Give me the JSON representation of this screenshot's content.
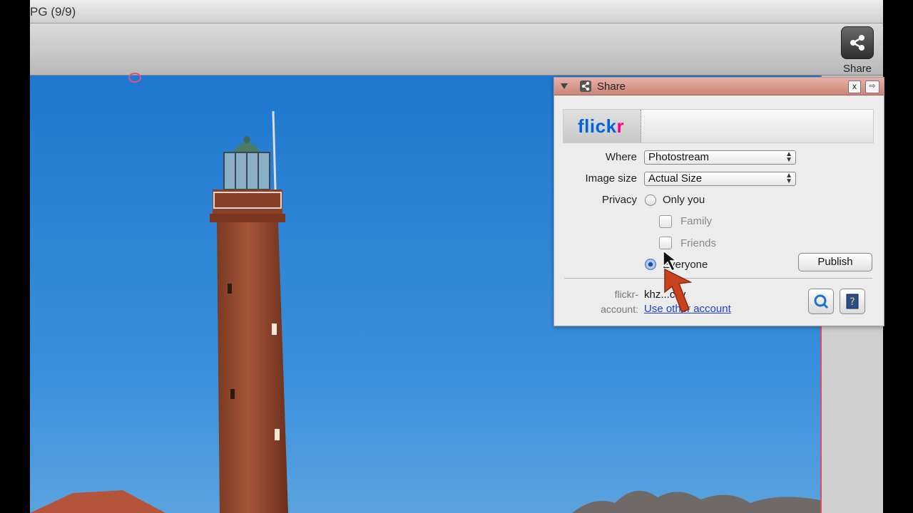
{
  "window": {
    "title": "PG (9/9)"
  },
  "toolbar": {
    "share_label": "Share"
  },
  "panel": {
    "title": "Share",
    "close_label": "x",
    "service_logo": {
      "part1": "flick",
      "part2": "r",
      "color_blue": "#0063dc",
      "color_pink": "#ff0084"
    },
    "where_label": "Where",
    "where_value": "Photostream",
    "size_label": "Image size",
    "size_value": "Actual Size",
    "privacy_label": "Privacy",
    "privacy_options": {
      "only_you": "Only you",
      "family": "Family",
      "friends": "Friends",
      "everyone": "Everyone"
    },
    "privacy_selected": "everyone",
    "publish_label": "Publish",
    "account_label_1": "flickr-",
    "account_label_2": "account:",
    "account_name": "khz...cky",
    "use_other_account": "Use other account",
    "icons": [
      "search-icon",
      "help-icon"
    ]
  },
  "colors": {
    "panel_header": "#cc8477",
    "sky": "#2b82d6",
    "link": "#1b3fd8"
  }
}
